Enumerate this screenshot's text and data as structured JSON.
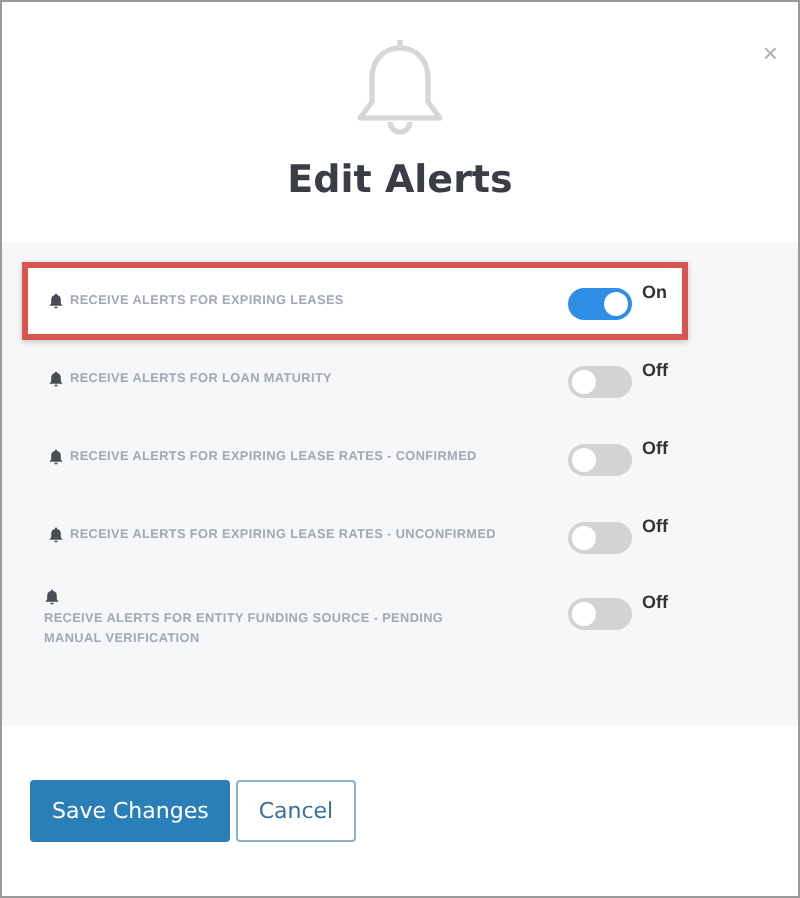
{
  "dialog": {
    "title": "Edit Alerts",
    "close": "×"
  },
  "alerts": [
    {
      "kind": "inline",
      "label": "RECEIVE ALERTS FOR EXPIRING LEASES",
      "on": true,
      "state_label": "On",
      "highlighted": true
    },
    {
      "kind": "inline",
      "label": "RECEIVE ALERTS FOR LOAN MATURITY",
      "on": false,
      "state_label": "Off",
      "highlighted": false
    },
    {
      "kind": "inline",
      "label": "RECEIVE ALERTS FOR EXPIRING LEASE RATES - CONFIRMED",
      "on": false,
      "state_label": "Off",
      "highlighted": false
    },
    {
      "kind": "inline",
      "label": "RECEIVE ALERTS FOR EXPIRING LEASE RATES - UNCONFIRMED",
      "on": false,
      "state_label": "Off",
      "highlighted": false
    },
    {
      "kind": "stacked",
      "label": "RECEIVE ALERTS FOR ENTITY FUNDING SOURCE - PENDING MANUAL VERIFICATION",
      "on": false,
      "state_label": "Off",
      "highlighted": false
    }
  ],
  "buttons": [
    {
      "label": "Save Changes",
      "kind": "primary"
    },
    {
      "label": "Cancel",
      "kind": "secondary"
    }
  ]
}
